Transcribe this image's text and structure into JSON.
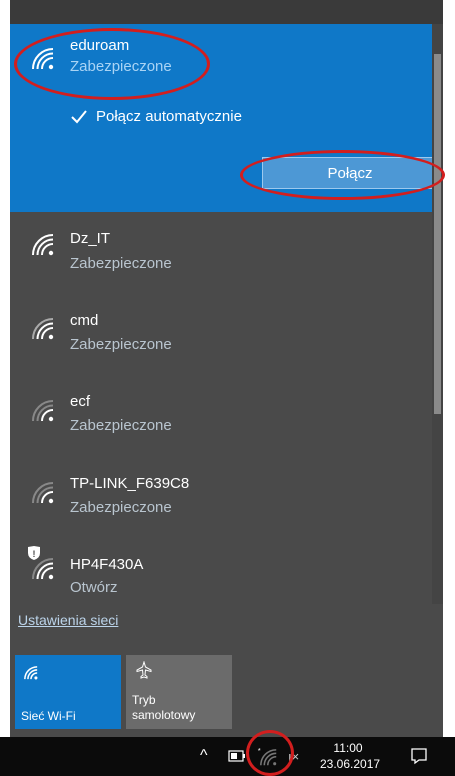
{
  "networks": [
    {
      "name": "eduroam",
      "status": "Zabezpieczone"
    },
    {
      "name": "Dz_IT",
      "status": "Zabezpieczone"
    },
    {
      "name": "cmd",
      "status": "Zabezpieczone"
    },
    {
      "name": "ecf",
      "status": "Zabezpieczone"
    },
    {
      "name": "TP-LINK_F639C8",
      "status": "Zabezpieczone"
    },
    {
      "name": "HP4F430A",
      "status": "Otwórz"
    }
  ],
  "selected": {
    "auto_connect_label": "Połącz automatycznie",
    "auto_connect_checked": true,
    "connect_label": "Połącz"
  },
  "settings_link": "Ustawienia sieci",
  "tiles": {
    "wifi_label": "Sieć Wi-Fi",
    "airplane_label_1": "Tryb",
    "airplane_label_2": "samolotowy"
  },
  "taskbar": {
    "time": "11:00",
    "date": "23.06.2017"
  },
  "colors": {
    "accent": "#0f78c8",
    "annotation": "#d21e1e"
  }
}
